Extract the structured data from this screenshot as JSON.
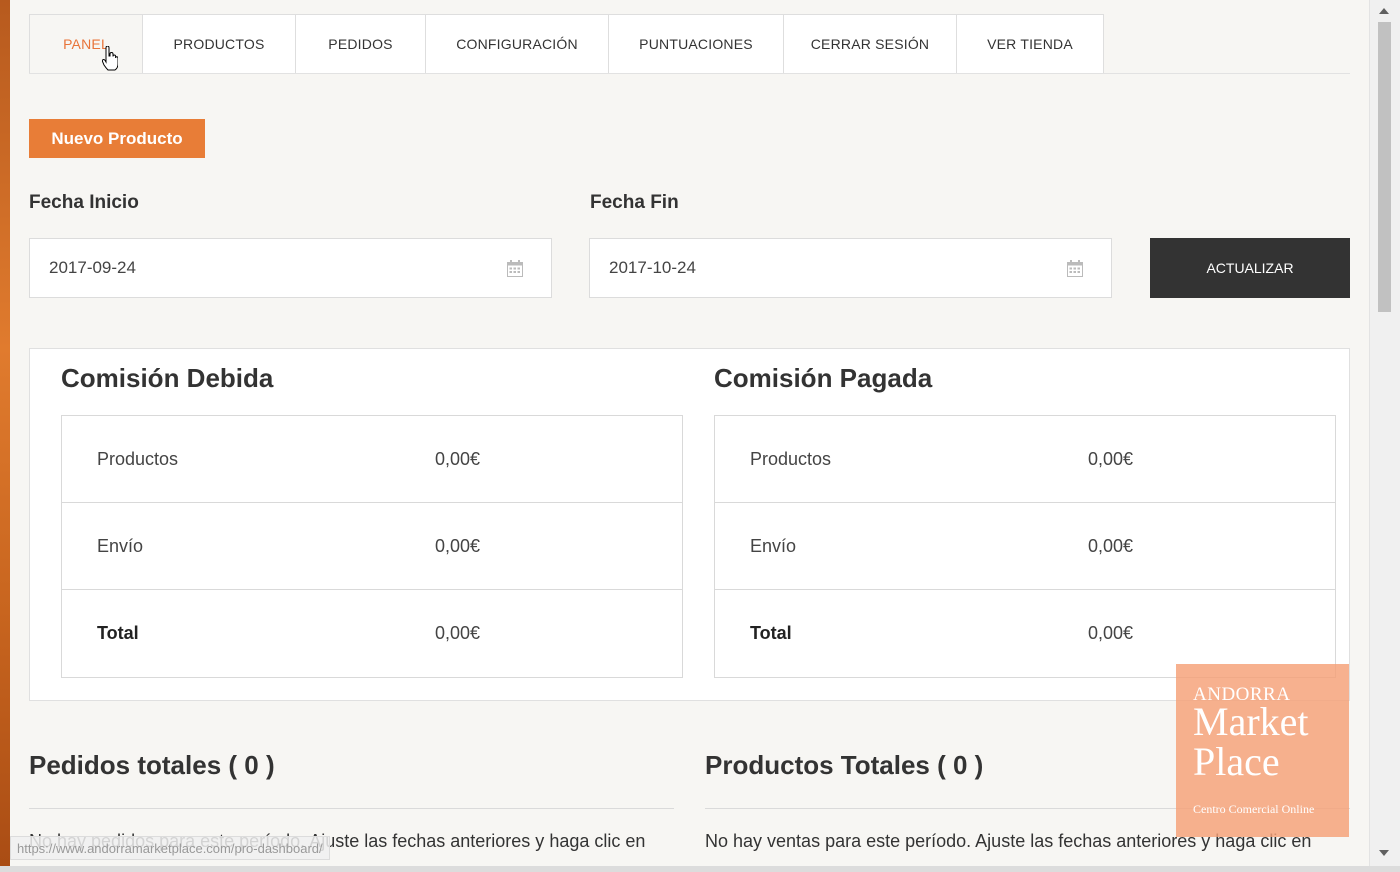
{
  "tabs": [
    {
      "label": "PANEL",
      "active": true
    },
    {
      "label": "PRODUCTOS",
      "active": false
    },
    {
      "label": "PEDIDOS",
      "active": false
    },
    {
      "label": "CONFIGURACIÓN",
      "active": false
    },
    {
      "label": "PUNTUACIONES",
      "active": false
    },
    {
      "label": "CERRAR SESIÓN",
      "active": false
    },
    {
      "label": "VER TIENDA",
      "active": false
    }
  ],
  "new_product_label": "Nuevo Producto",
  "filters": {
    "start_label": "Fecha Inicio",
    "start_value": "2017-09-24",
    "end_label": "Fecha Fin",
    "end_value": "2017-10-24",
    "update_label": "ACTUALIZAR"
  },
  "commission_due": {
    "title": "Comisión Debida",
    "rows": [
      {
        "label": "Productos",
        "value": "0,00€"
      },
      {
        "label": "Envío",
        "value": "0,00€"
      },
      {
        "label": "Total",
        "value": "0,00€"
      }
    ]
  },
  "commission_paid": {
    "title": "Comisión Pagada",
    "rows": [
      {
        "label": "Productos",
        "value": "0,00€"
      },
      {
        "label": "Envío",
        "value": "0,00€"
      },
      {
        "label": "Total",
        "value": "0,00€"
      }
    ]
  },
  "orders": {
    "title": "Pedidos totales ( 0 )",
    "message": "No hay pedidos para este período. Ajuste las fechas anteriores y haga clic en"
  },
  "products": {
    "title": "Productos Totales ( 0 )",
    "message": "No hay ventas para este período. Ajuste las fechas anteriores y haga clic en"
  },
  "status_url": "https://www.andorramarketplace.com/pro-dashboard/",
  "logo": {
    "line1": "ANDORRA",
    "line2": "Market",
    "line3": "Place",
    "tagline": "Centro Comercial Online"
  },
  "colors": {
    "accent": "#e87d37",
    "dark_button": "#333333",
    "background": "#f7f6f3"
  }
}
